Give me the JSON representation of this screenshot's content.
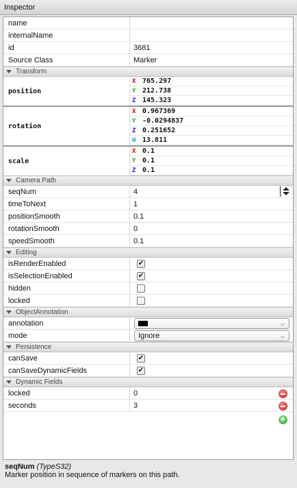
{
  "window": {
    "title": "Inspector"
  },
  "colors": {
    "x_axis": "#cc0000",
    "y_axis": "#22aa22",
    "z_axis": "#1c1ccc",
    "w_axis": "#22a6c8"
  },
  "general": [
    {
      "label": "name",
      "value": ""
    },
    {
      "label": "internalName",
      "value": ""
    },
    {
      "label": "id",
      "value": "3681"
    },
    {
      "label": "Source Class",
      "value": "Marker"
    }
  ],
  "transform": {
    "title": "Transform",
    "position": {
      "label": "position",
      "x": "765.297",
      "y": "212.738",
      "z": "145.323"
    },
    "rotation": {
      "label": "rotation",
      "x": "0.967369",
      "y": "-0.0294837",
      "z": "0.251652",
      "w": "13.811"
    },
    "scale": {
      "label": "scale",
      "x": "0.1",
      "y": "0.1",
      "z": "0.1"
    },
    "axis_labels": {
      "x": "X",
      "y": "Y",
      "z": "Z",
      "w": "W"
    }
  },
  "camera_path": {
    "title": "Camera Path",
    "rows": [
      {
        "label": "seqNum",
        "value": "4"
      },
      {
        "label": "timeToNext",
        "value": "1"
      },
      {
        "label": "positionSmooth",
        "value": "0.1"
      },
      {
        "label": "rotationSmooth",
        "value": "0"
      },
      {
        "label": "speedSmooth",
        "value": "0.1"
      }
    ]
  },
  "editing": {
    "title": "Editing",
    "rows": [
      {
        "label": "isRenderEnabled",
        "checked": "✔"
      },
      {
        "label": "isSelectionEnabled",
        "checked": "✔"
      },
      {
        "label": "hidden",
        "checked": ""
      },
      {
        "label": "locked",
        "checked": ""
      }
    ]
  },
  "object_annotation": {
    "title": "ObjectAnnotation",
    "annotation_label": "annotation",
    "annotation_color": "#000000",
    "mode_label": "mode",
    "mode_value": "Ignore"
  },
  "persistence": {
    "title": "Persistence",
    "rows": [
      {
        "label": "canSave",
        "checked": "✔"
      },
      {
        "label": "canSaveDynamicFields",
        "checked": "✔"
      }
    ]
  },
  "dynamic_fields": {
    "title": "Dynamic Fields",
    "rows": [
      {
        "label": "locked",
        "value": "0"
      },
      {
        "label": "seconds",
        "value": "3"
      }
    ]
  },
  "help": {
    "field": "seqNum",
    "type": "(TypeS32)",
    "description": "Marker position in sequence of markers on this path."
  }
}
